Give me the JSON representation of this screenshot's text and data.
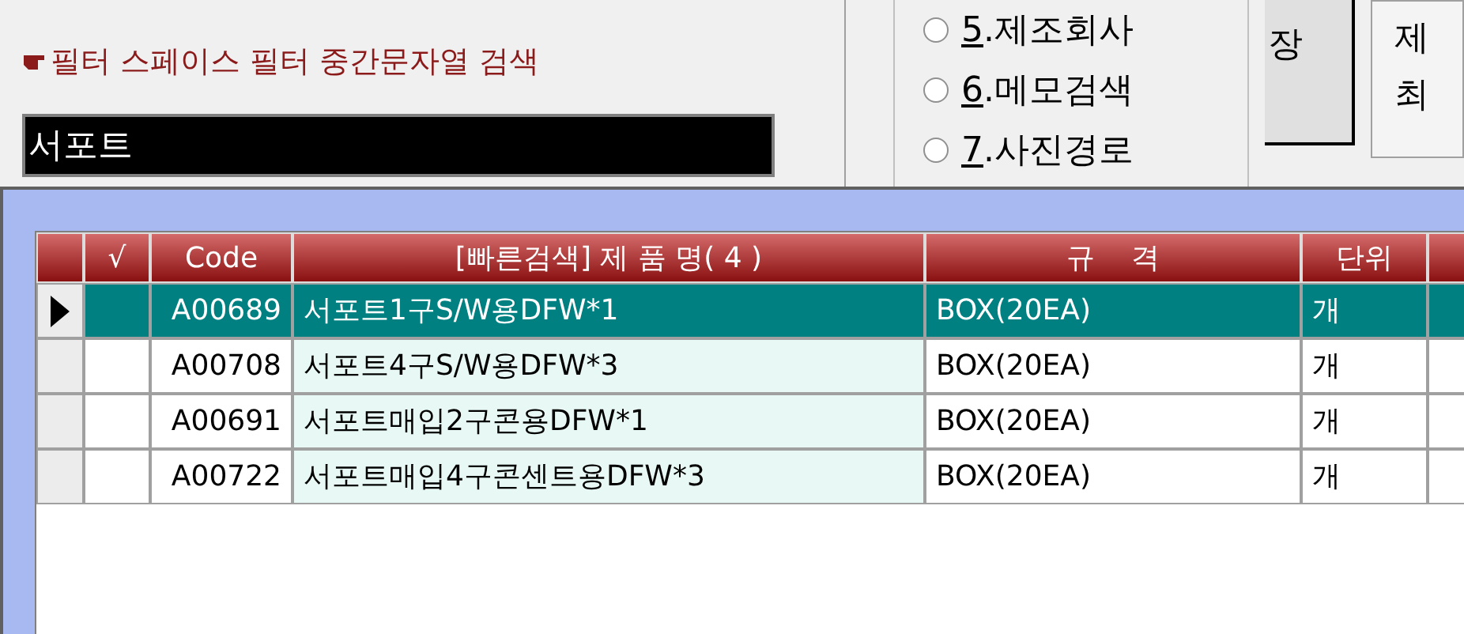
{
  "filter_label": "필터 스페이스 필터 중간문자열 검색",
  "search": {
    "value": "서포트"
  },
  "radio_options": [
    {
      "number": "5",
      "label": ".제조회사",
      "selected": false
    },
    {
      "number": "6",
      "label": ".메모검색",
      "selected": false
    },
    {
      "number": "7",
      "label": ".사진경로",
      "selected": false
    }
  ],
  "side_button": "장",
  "side_panel": [
    "제",
    "최"
  ],
  "table": {
    "columns": [
      "√",
      "Code",
      "[빠른검색] 제 품 명( 4 )",
      "규    격",
      "단위"
    ],
    "rows": [
      {
        "selected": true,
        "code": "A00689",
        "name": "서포트1구S/W용DFW*1",
        "spec": "BOX(20EA)",
        "unit": "개"
      },
      {
        "selected": false,
        "code": "A00708",
        "name": "서포트4구S/W용DFW*3",
        "spec": "BOX(20EA)",
        "unit": "개"
      },
      {
        "selected": false,
        "code": "A00691",
        "name": "서포트매입2구콘용DFW*1",
        "spec": "BOX(20EA)",
        "unit": "개"
      },
      {
        "selected": false,
        "code": "A00722",
        "name": "서포트매입4구콘센트용DFW*3",
        "spec": "BOX(20EA)",
        "unit": "개"
      }
    ]
  }
}
